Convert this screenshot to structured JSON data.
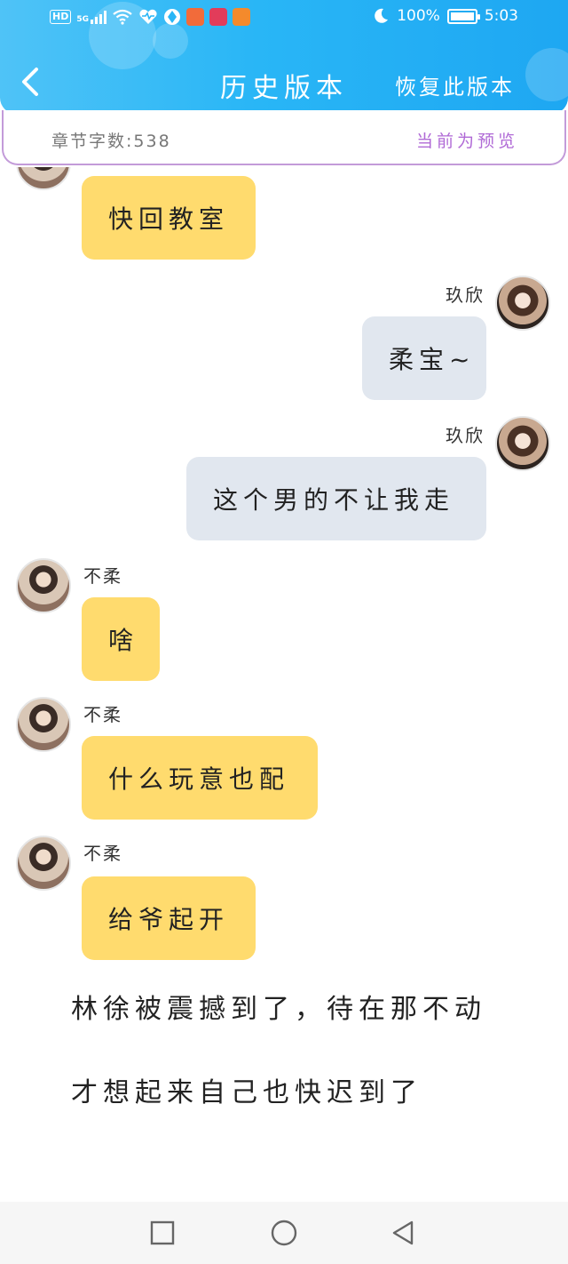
{
  "status_bar": {
    "hd": "HD",
    "network": "5G",
    "battery_percent": "100%",
    "battery_level": 1.0,
    "time": "5:03",
    "icons": [
      "wifi-icon",
      "health-icon",
      "app-icon",
      "app-icon",
      "app-icon",
      "app-icon",
      "moon-icon",
      "battery-icon"
    ]
  },
  "nav": {
    "title": "历史版本",
    "action": "恢复此版本"
  },
  "info": {
    "word_count_label": "章节字数:538",
    "preview_label": "当前为预览"
  },
  "messages": [
    {
      "side": "left",
      "sender": "",
      "text": "快回教室"
    },
    {
      "side": "right",
      "sender": "玖欣",
      "text": "柔宝~"
    },
    {
      "side": "right",
      "sender": "玖欣",
      "text": "这个男的不让我走"
    },
    {
      "side": "left",
      "sender": "不柔",
      "text": "啥"
    },
    {
      "side": "left",
      "sender": "不柔",
      "text": "什么玩意也配"
    },
    {
      "side": "left",
      "sender": "不柔",
      "text": "给爷起开"
    }
  ],
  "narration": [
    "林徐被震撼到了，待在那不动",
    "才想起来自己也快迟到了"
  ],
  "colors": {
    "header_start": "#4fc3f7",
    "header_end": "#1ea7f2",
    "left_bubble": "#ffdb6e",
    "right_bubble": "#e1e7ef",
    "accent_purple": "#b06ad6"
  }
}
